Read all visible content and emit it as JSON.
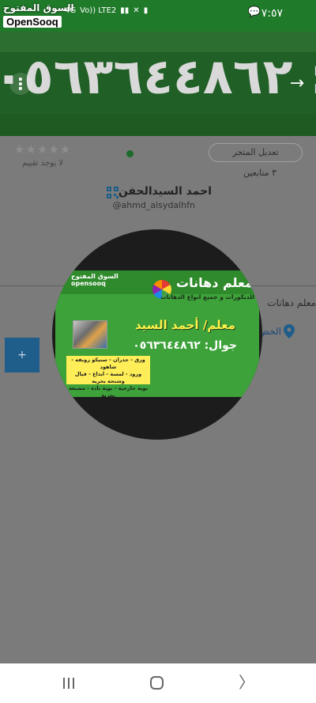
{
  "status_bar": {
    "time": "٧:٥٧",
    "network_label": "4G",
    "volte_label": "Vo)) LTE2",
    "logo_text_ar": "السوق المفتوح",
    "logo_text_en": "OpenSooq"
  },
  "cover": {
    "phone_number": "٠٥٦٣٦٤٤٨٦٢ :"
  },
  "profile": {
    "edit_store_label": "تعديل المتجر",
    "followers_label": "٣ متابعين",
    "stars": "★★★★★",
    "no_rating_label": "لا يوجد تقييم",
    "name": "احمد السيدالحفن",
    "handle": "@ahmd_alsydalhfn",
    "description": "معلم دهانات",
    "location": "الخض",
    "add_label": "+"
  },
  "avatar_card": {
    "watermark": "السوق المفتوح\nopensooq",
    "title": "معلم دهانات",
    "subtitle": "للديكورات و جميع انواع الدهانات",
    "name": "معلم/ أحمد السيد",
    "phone": "جوال: ٠٥٦٣٦٤٤٨٦٢",
    "services": "ورق - جدران - سنيكو روبقه - شاهود\nورود - لمسة - ابداع - فيال وشتحه بحريه\nبوية خارجية - بوية نادة - مشبغة بحرية"
  },
  "colors": {
    "status_bar": "#1f7a2a",
    "overlay": "#7b7b7b",
    "card_green": "#3da23a",
    "accent_blue": "#1f5d8a"
  }
}
